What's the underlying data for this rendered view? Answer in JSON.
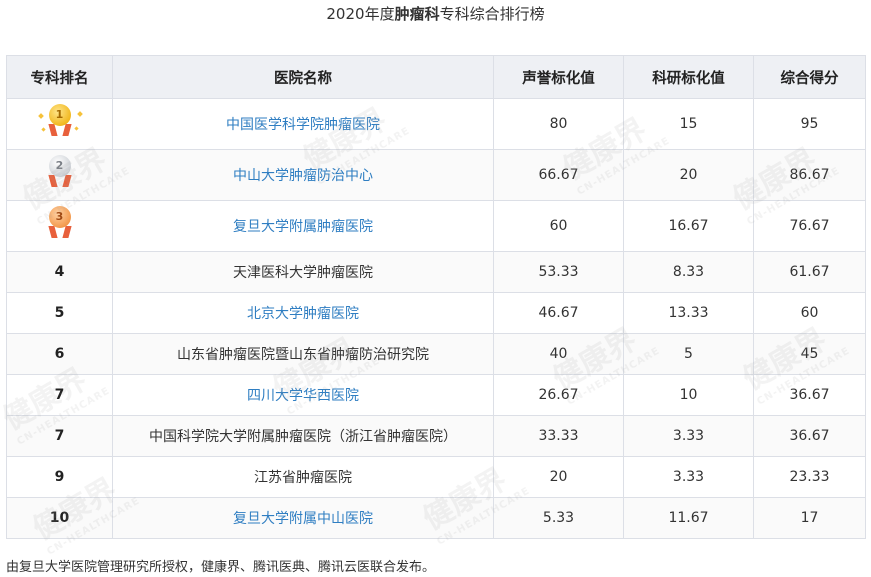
{
  "title": {
    "prefix": "2020年度",
    "bold": "肿瘤科",
    "suffix": "专科综合排行榜"
  },
  "table": {
    "headers": [
      "专科排名",
      "医院名称",
      "声誉标化值",
      "科研标化值",
      "综合得分"
    ],
    "rows": [
      {
        "rank": "1",
        "hospital": "中国医学科学院肿瘤医院",
        "reputation": "80",
        "research": "15",
        "score": "95"
      },
      {
        "rank": "2",
        "hospital": "中山大学肿瘤防治中心",
        "reputation": "66.67",
        "research": "20",
        "score": "86.67"
      },
      {
        "rank": "3",
        "hospital": "复旦大学附属肿瘤医院",
        "reputation": "60",
        "research": "16.67",
        "score": "76.67"
      },
      {
        "rank": "4",
        "hospital": "天津医科大学肿瘤医院",
        "reputation": "53.33",
        "research": "8.33",
        "score": "61.67"
      },
      {
        "rank": "5",
        "hospital": "北京大学肿瘤医院",
        "reputation": "46.67",
        "research": "13.33",
        "score": "60"
      },
      {
        "rank": "6",
        "hospital": "山东省肿瘤医院暨山东省肿瘤防治研究院",
        "reputation": "40",
        "research": "5",
        "score": "45"
      },
      {
        "rank": "7",
        "hospital": "四川大学华西医院",
        "reputation": "26.67",
        "research": "10",
        "score": "36.67"
      },
      {
        "rank": "7",
        "hospital": "中国科学院大学附属肿瘤医院（浙江省肿瘤医院）",
        "reputation": "33.33",
        "research": "3.33",
        "score": "36.67"
      },
      {
        "rank": "9",
        "hospital": "江苏省肿瘤医院",
        "reputation": "20",
        "research": "3.33",
        "score": "23.33"
      },
      {
        "rank": "10",
        "hospital": "复旦大学附属中山医院",
        "reputation": "5.33",
        "research": "11.67",
        "score": "17"
      }
    ]
  },
  "watermark": {
    "main": "健康界",
    "sub": "CN-HEALTHCARE"
  },
  "footer": "由复旦大学医院管理研究所授权，健康界、腾讯医典、腾讯云医联合发布。",
  "colors": {
    "link": "#2f7ec2",
    "header_bg": "#eef0f4",
    "border": "#dcdfe6"
  }
}
